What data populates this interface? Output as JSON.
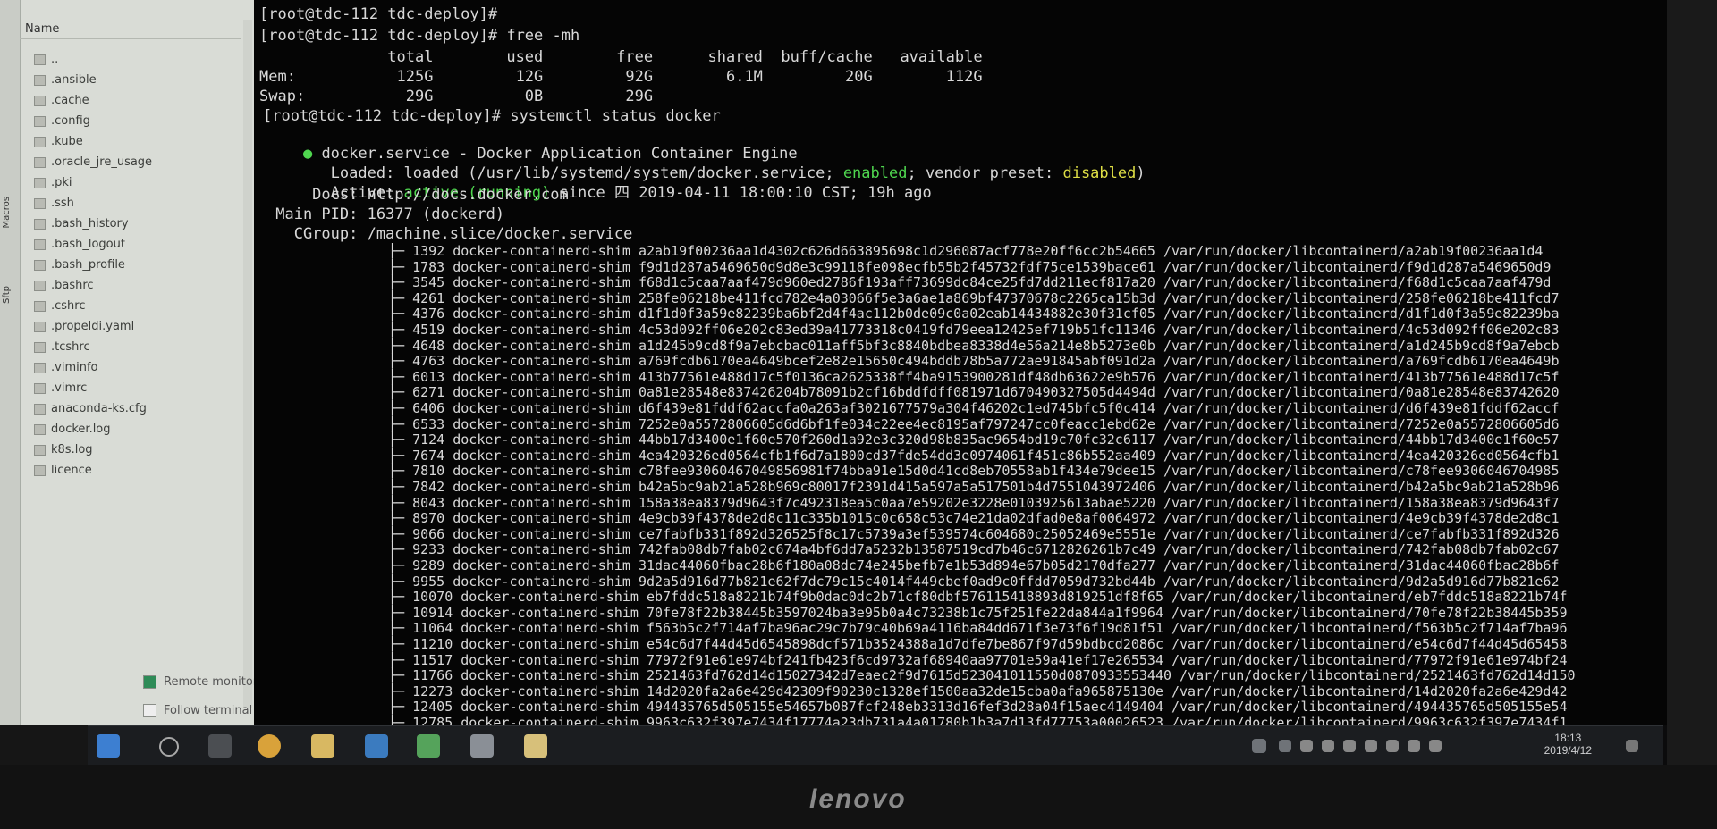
{
  "file_panel": {
    "side_tabs": [
      "Sftp",
      "Macros"
    ],
    "header_label": "Name",
    "items": [
      {
        "label": ".."
      },
      {
        "label": ".ansible"
      },
      {
        "label": ".cache"
      },
      {
        "label": ".config"
      },
      {
        "label": ".kube"
      },
      {
        "label": ".oracle_jre_usage"
      },
      {
        "label": ".pki"
      },
      {
        "label": ".ssh"
      },
      {
        "label": ".bash_history"
      },
      {
        "label": ".bash_logout"
      },
      {
        "label": ".bash_profile"
      },
      {
        "label": ".bashrc"
      },
      {
        "label": ".cshrc"
      },
      {
        "label": ".propeldi.yaml"
      },
      {
        "label": ".tcshrc"
      },
      {
        "label": ".viminfo"
      },
      {
        "label": ".vimrc"
      },
      {
        "label": "anaconda-ks.cfg"
      },
      {
        "label": "docker.log"
      },
      {
        "label": "k8s.log"
      },
      {
        "label": "licence"
      }
    ],
    "remote_monitoring_label": "Remote monitoring",
    "follow_folder_label": "Follow terminal folder"
  },
  "terminal": {
    "prompt_top": "[root@tdc-112 tdc-deploy]#",
    "cmd1": "[root@tdc-112 tdc-deploy]# free -mh",
    "mem_header": "              total        used        free      shared  buff/cache   available",
    "mem_row": "Mem:           125G         12G         92G        6.1M         20G        112G",
    "swap_row": "Swap:           29G          0B         29G",
    "cmd2": "[root@tdc-112 tdc-deploy]# systemctl status docker",
    "svc_bullet": "●",
    "svc_name": " docker.service - Docker Application Container Engine",
    "loaded_prefix": "   Loaded: loaded (/usr/lib/systemd/system/docker.service; ",
    "loaded_enabled": "enabled",
    "loaded_mid": "; vendor preset: ",
    "loaded_disabled": "disabled",
    "loaded_suffix": ")",
    "active_prefix": "   Active: ",
    "active_state": "active (running)",
    "active_suffix": " since 四 2019-04-11 18:00:10 CST; 19h ago",
    "docs": "     Docs: http://docs.docker.com",
    "main_pid": " Main PID: 16377 (dockerd)",
    "cgroup": "   CGroup: /machine.slice/docker.service",
    "processes": [
      {
        "pid": "1392",
        "hash": "a2ab19f00236aa1d4302c626d663895698c1d296087acf778e20ff6cc2b54665",
        "path": "/var/run/docker/libcontainerd/a2ab19f00236aa1d4"
      },
      {
        "pid": "1783",
        "hash": "f9d1d287a5469650d9d8e3c99118fe098ecfb55b2f45732fdf75ce1539bace61",
        "path": "/var/run/docker/libcontainerd/f9d1d287a5469650d9"
      },
      {
        "pid": "3545",
        "hash": "f68d1c5caa7aaf479d960ed2786f193aff73699dc84ce25fd7dd211ecf817a20",
        "path": "/var/run/docker/libcontainerd/f68d1c5caa7aaf479d"
      },
      {
        "pid": "4261",
        "hash": "258fe06218be411fcd782e4a03066f5e3a6ae1a869bf47370678c2265ca15b3d",
        "path": "/var/run/docker/libcontainerd/258fe06218be411fcd7"
      },
      {
        "pid": "4376",
        "hash": "d1f1d0f3a59e82239ba6bf2d4f4ac112b0de09c0a02eab14434882e30f31cf05",
        "path": "/var/run/docker/libcontainerd/d1f1d0f3a59e82239ba"
      },
      {
        "pid": "4519",
        "hash": "4c53d092ff06e202c83ed39a41773318c0419fd79eea12425ef719b51fc11346",
        "path": "/var/run/docker/libcontainerd/4c53d092ff06e202c83"
      },
      {
        "pid": "4648",
        "hash": "a1d245b9cd8f9a7ebcbac011aff5bf3c8840bdbea8338d4e56a214e8b5273e0b",
        "path": "/var/run/docker/libcontainerd/a1d245b9cd8f9a7ebcb"
      },
      {
        "pid": "4763",
        "hash": "a769fcdb6170ea4649bcef2e82e15650c494bddb78b5a772ae91845abf091d2a",
        "path": "/var/run/docker/libcontainerd/a769fcdb6170ea4649b"
      },
      {
        "pid": "6013",
        "hash": "413b77561e488d17c5f0136ca2625338ff4ba9153900281df48db63622e9b576",
        "path": "/var/run/docker/libcontainerd/413b77561e488d17c5f"
      },
      {
        "pid": "6271",
        "hash": "0a81e28548e837426204b78091b2cf16bddfdff081971d670490327505d4494d",
        "path": "/var/run/docker/libcontainerd/0a81e28548e83742620"
      },
      {
        "pid": "6406",
        "hash": "d6f439e81fddf62accfa0a263af3021677579a304f46202c1ed745bfc5f0c414",
        "path": "/var/run/docker/libcontainerd/d6f439e81fddf62accf"
      },
      {
        "pid": "6533",
        "hash": "7252e0a5572806605d6d6bf1fe034c22ee4ec8195af797247cc0feacc1ebd62e",
        "path": "/var/run/docker/libcontainerd/7252e0a5572806605d6"
      },
      {
        "pid": "7124",
        "hash": "44bb17d3400e1f60e570f260d1a92e3c320d98b835ac9654bd19c70fc32c6117",
        "path": "/var/run/docker/libcontainerd/44bb17d3400e1f60e57"
      },
      {
        "pid": "7674",
        "hash": "4ea420326ed0564cfb1f6d7a1800cd37fde54dd3e0974061f451c86b552aa409",
        "path": "/var/run/docker/libcontainerd/4ea420326ed0564cfb1"
      },
      {
        "pid": "7810",
        "hash": "c78fee93060467049856981f74bba91e15d0d41cd8eb70558ab1f434e79dee15",
        "path": "/var/run/docker/libcontainerd/c78fee9306046704985"
      },
      {
        "pid": "7842",
        "hash": "b42a5bc9ab21a528b969c80017f2391d415a597a5a517501b4d7551043972406",
        "path": "/var/run/docker/libcontainerd/b42a5bc9ab21a528b96"
      },
      {
        "pid": "8043",
        "hash": "158a38ea8379d9643f7c492318ea5c0aa7e59202e3228e0103925613abae5220",
        "path": "/var/run/docker/libcontainerd/158a38ea8379d9643f7"
      },
      {
        "pid": "8970",
        "hash": "4e9cb39f4378de2d8c11c335b1015c0c658c53c74e21da02dfad0e8af0064972",
        "path": "/var/run/docker/libcontainerd/4e9cb39f4378de2d8c1"
      },
      {
        "pid": "9066",
        "hash": "ce7fabfb331f892d326525f8c17c5739a3ef539574c604680c25052469e5551e",
        "path": "/var/run/docker/libcontainerd/ce7fabfb331f892d326"
      },
      {
        "pid": "9233",
        "hash": "742fab08db7fab02c674a4bf6dd7a5232b13587519cd7b46c6712826261b7c49",
        "path": "/var/run/docker/libcontainerd/742fab08db7fab02c67"
      },
      {
        "pid": "9289",
        "hash": "31dac44060fbac28b6f180a08dc74e245befb7e1b53d894e67b05d2170dfa277",
        "path": "/var/run/docker/libcontainerd/31dac44060fbac28b6f"
      },
      {
        "pid": "9955",
        "hash": "9d2a5d916d77b821e62f7dc79c15c4014f449cbef0ad9c0ffdd7059d732bd44b",
        "path": "/var/run/docker/libcontainerd/9d2a5d916d77b821e62"
      },
      {
        "pid": "10070",
        "hash": "eb7fddc518a8221b74f9b0dac0dc2b71cf80dbf576115418893d819251df8f65",
        "path": "/var/run/docker/libcontainerd/eb7fddc518a8221b74f"
      },
      {
        "pid": "10914",
        "hash": "70fe78f22b38445b3597024ba3e95b0a4c73238b1c75f251fe22da844a1f9964",
        "path": "/var/run/docker/libcontainerd/70fe78f22b38445b359"
      },
      {
        "pid": "11064",
        "hash": "f563b5c2f714af7ba96ac29c7b79c40b69a4116ba84dd671f3e73f6f19d81f51",
        "path": "/var/run/docker/libcontainerd/f563b5c2f714af7ba96"
      },
      {
        "pid": "11210",
        "hash": "e54c6d7f44d45d6545898dcf571b3524388a1d7dfe7be867f97d59bdbcd2086c",
        "path": "/var/run/docker/libcontainerd/e54c6d7f44d45d65458"
      },
      {
        "pid": "11517",
        "hash": "77972f91e61e974bf241fb423f6cd9732af68940aa97701e59a41ef17e265534",
        "path": "/var/run/docker/libcontainerd/77972f91e61e974bf24"
      },
      {
        "pid": "11766",
        "hash": "2521463fd762d14d15027342d7eaec2f9d7615d523041011550d0870933553440",
        "path": "/var/run/docker/libcontainerd/2521463fd762d14d150"
      },
      {
        "pid": "12273",
        "hash": "14d2020fa2a6e429d42309f90230c1328ef1500aa32de15cba0afa965875130e",
        "path": "/var/run/docker/libcontainerd/14d2020fa2a6e429d42"
      },
      {
        "pid": "12405",
        "hash": "494435765d505155e54657b087fcf248eb3313d16fef3d28a04f15aec4149404",
        "path": "/var/run/docker/libcontainerd/494435765d505155e54"
      },
      {
        "pid": "12785",
        "hash": "9963c632f397e7434f17774a23db731a4a01780b1b3a7d13fd77753a00026523",
        "path": "/var/run/docker/libcontainerd/9963c632f397e7434f1"
      }
    ],
    "process_name": "docker-containerd-shim"
  },
  "taskbar": {
    "time": "18:13",
    "date": "2019/4/12"
  },
  "bezel": {
    "brand": "lenovo"
  },
  "colors": {
    "terminal_bg": "#050505",
    "terminal_text": "#d8d8d8",
    "green": "#4fd64f",
    "yellow": "#dede45"
  }
}
